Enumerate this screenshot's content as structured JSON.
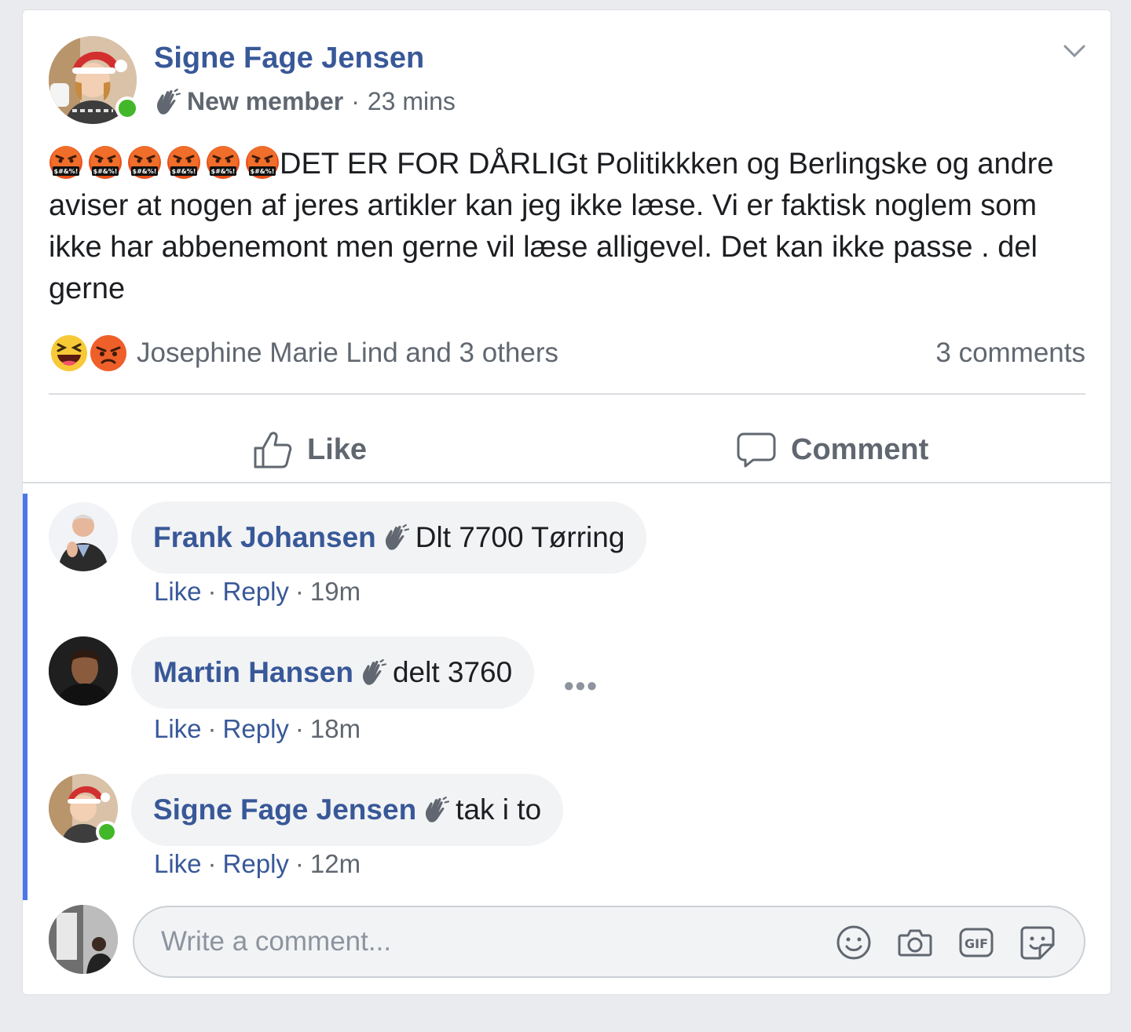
{
  "post": {
    "author": "Signe Fage Jensen",
    "badge": "New member",
    "separator": "·",
    "time": "23 mins",
    "text": "DET ER FOR DÅRLIGt Politikkken og Berlingske og andre aviser at nogen af jeres artikler kan jeg ikke læse. Vi er faktisk noglem som ikke har abbenemont men gerne vil læse alligevel. Det kan ikke passe . del gerne",
    "reactions_text": "Josephine Marie Lind and 3 others",
    "comments_count": "3 comments"
  },
  "actions": {
    "like": "Like",
    "comment": "Comment"
  },
  "comments": [
    {
      "author": "Frank Johansen",
      "text": "Dlt 7700 Tørring",
      "like": "Like",
      "reply": "Reply",
      "time": "19m"
    },
    {
      "author": "Martin Hansen",
      "text": "delt 3760",
      "like": "Like",
      "reply": "Reply",
      "time": "18m"
    },
    {
      "author": "Signe Fage Jensen",
      "text": "tak i to",
      "like": "Like",
      "reply": "Reply",
      "time": "12m"
    }
  ],
  "meta_separator": "·",
  "more_label": "•••",
  "composer": {
    "placeholder": "Write a comment..."
  },
  "icons": [
    "chevron-down-icon",
    "wave-icon",
    "angry-emoji-icon",
    "laugh-reaction-icon",
    "angry-reaction-icon",
    "like-icon",
    "comment-icon",
    "emoji-icon",
    "camera-icon",
    "gif-icon",
    "sticker-icon"
  ],
  "colors": {
    "link": "#385898",
    "muted": "#606770",
    "online": "#42b72a",
    "thread": "#4a76e8",
    "bubble": "#f2f3f5"
  }
}
